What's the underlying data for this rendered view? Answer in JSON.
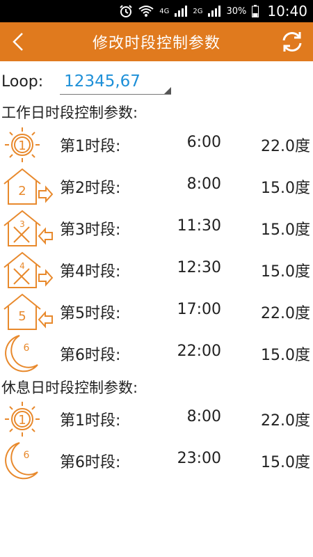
{
  "status_bar": {
    "time": "10:40",
    "battery": "30%",
    "net1": "4G",
    "net2": "4G",
    "net3": "2G"
  },
  "app_bar": {
    "title": "修改时段控制参数"
  },
  "loop": {
    "label": "Loop:",
    "value": "12345,67"
  },
  "workday": {
    "title": "工作日时段控制参数:",
    "rows": [
      {
        "label": "第1时段:",
        "time": "6:00",
        "temp": "22.0度",
        "icon": "sun-icon",
        "num": "1"
      },
      {
        "label": "第2时段:",
        "time": "8:00",
        "temp": "15.0度",
        "icon": "house-leave-icon",
        "num": "2"
      },
      {
        "label": "第3时段:",
        "time": "11:30",
        "temp": "15.0度",
        "icon": "house-return-icon",
        "num": "3"
      },
      {
        "label": "第4时段:",
        "time": "12:30",
        "temp": "15.0度",
        "icon": "house-leave-icon",
        "num": "4"
      },
      {
        "label": "第5时段:",
        "time": "17:00",
        "temp": "22.0度",
        "icon": "house-return-icon",
        "num": "5"
      },
      {
        "label": "第6时段:",
        "time": "22:00",
        "temp": "15.0度",
        "icon": "moon-icon",
        "num": "6"
      }
    ]
  },
  "restday": {
    "title": "休息日时段控制参数:",
    "rows": [
      {
        "label": "第1时段:",
        "time": "8:00",
        "temp": "22.0度",
        "icon": "sun-icon",
        "num": "1"
      },
      {
        "label": "第6时段:",
        "time": "23:00",
        "temp": "15.0度",
        "icon": "moon-icon",
        "num": "6"
      }
    ]
  },
  "colors": {
    "accent": "#E07A1E",
    "icon": "#E8892C",
    "loop_value": "#1E90D8"
  }
}
